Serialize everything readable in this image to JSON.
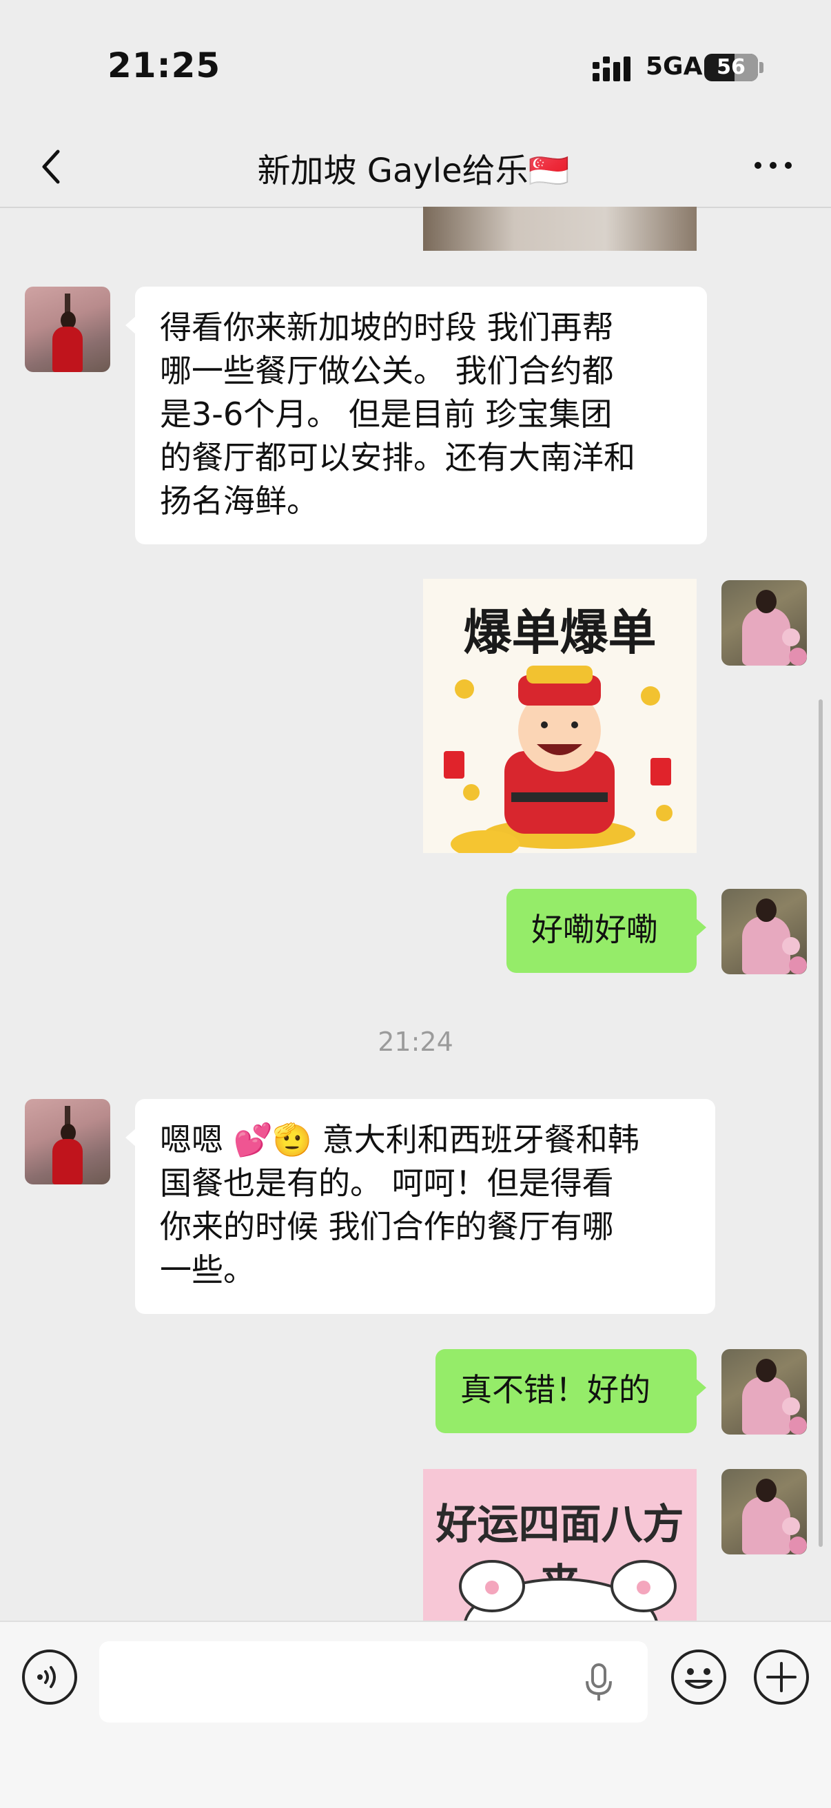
{
  "status_bar": {
    "time": "21:25",
    "network": "5GA",
    "battery": "56"
  },
  "header": {
    "title": "新加坡 Gayle给乐🇸🇬"
  },
  "messages": [
    {
      "sender": "contact",
      "type": "text",
      "text_lines": [
        "得看你来新加坡的时段 我们再帮",
        "哪一些餐厅做公关。 我们合约都",
        "是3-6个月。 但是目前 珍宝集团",
        "的餐厅都可以安排。还有大南洋和",
        "扬名海鲜。"
      ]
    },
    {
      "sender": "me",
      "type": "sticker",
      "caption": "爆单爆单",
      "icon": "god-of-wealth-sticker"
    },
    {
      "sender": "me",
      "type": "text",
      "text": "好嘞好嘞"
    },
    {
      "sender": "contact",
      "type": "text",
      "text_lines": [
        "嗯嗯 💕🫡 意大利和西班牙餐和韩",
        "国餐也是有的。 呵呵！但是得看",
        "你来的时候 我们合作的餐厅有哪",
        "一些。"
      ]
    },
    {
      "sender": "me",
      "type": "text",
      "text": "真不错！好的"
    },
    {
      "sender": "me",
      "type": "sticker",
      "caption": "好运四面八方来",
      "icon": "cat-paws-sticker"
    }
  ],
  "divider_time": "21:24",
  "input_bar": {
    "placeholder": "",
    "icons": [
      "voice-mode-icon",
      "microphone-icon",
      "emoji-icon",
      "plus-icon"
    ]
  },
  "colors": {
    "background": "#ededed",
    "my_bubble": "#95ec69",
    "their_bubble": "#ffffff"
  }
}
